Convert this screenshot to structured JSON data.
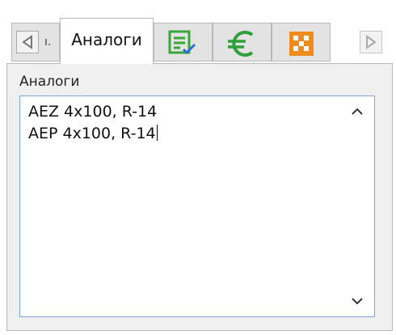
{
  "tabs": {
    "clipped_label": "ı.",
    "active_label": "Аналоги",
    "icons": [
      {
        "name": "checklist-icon",
        "color": "#3aa63a",
        "accent": "#2b6fd6"
      },
      {
        "name": "euro-icon",
        "color": "#2f9e3c"
      },
      {
        "name": "grid-icon",
        "color": "#f08c1e"
      }
    ]
  },
  "panel": {
    "group_label": "Аналоги",
    "memo_lines": [
      "AEZ 4x100, R-14",
      "AEP 4x100, R-14"
    ]
  },
  "colors": {
    "memo_border": "#7fa7d6",
    "panel_bg": "#f0f0f0",
    "tab_bg": "#e3e3e3"
  }
}
